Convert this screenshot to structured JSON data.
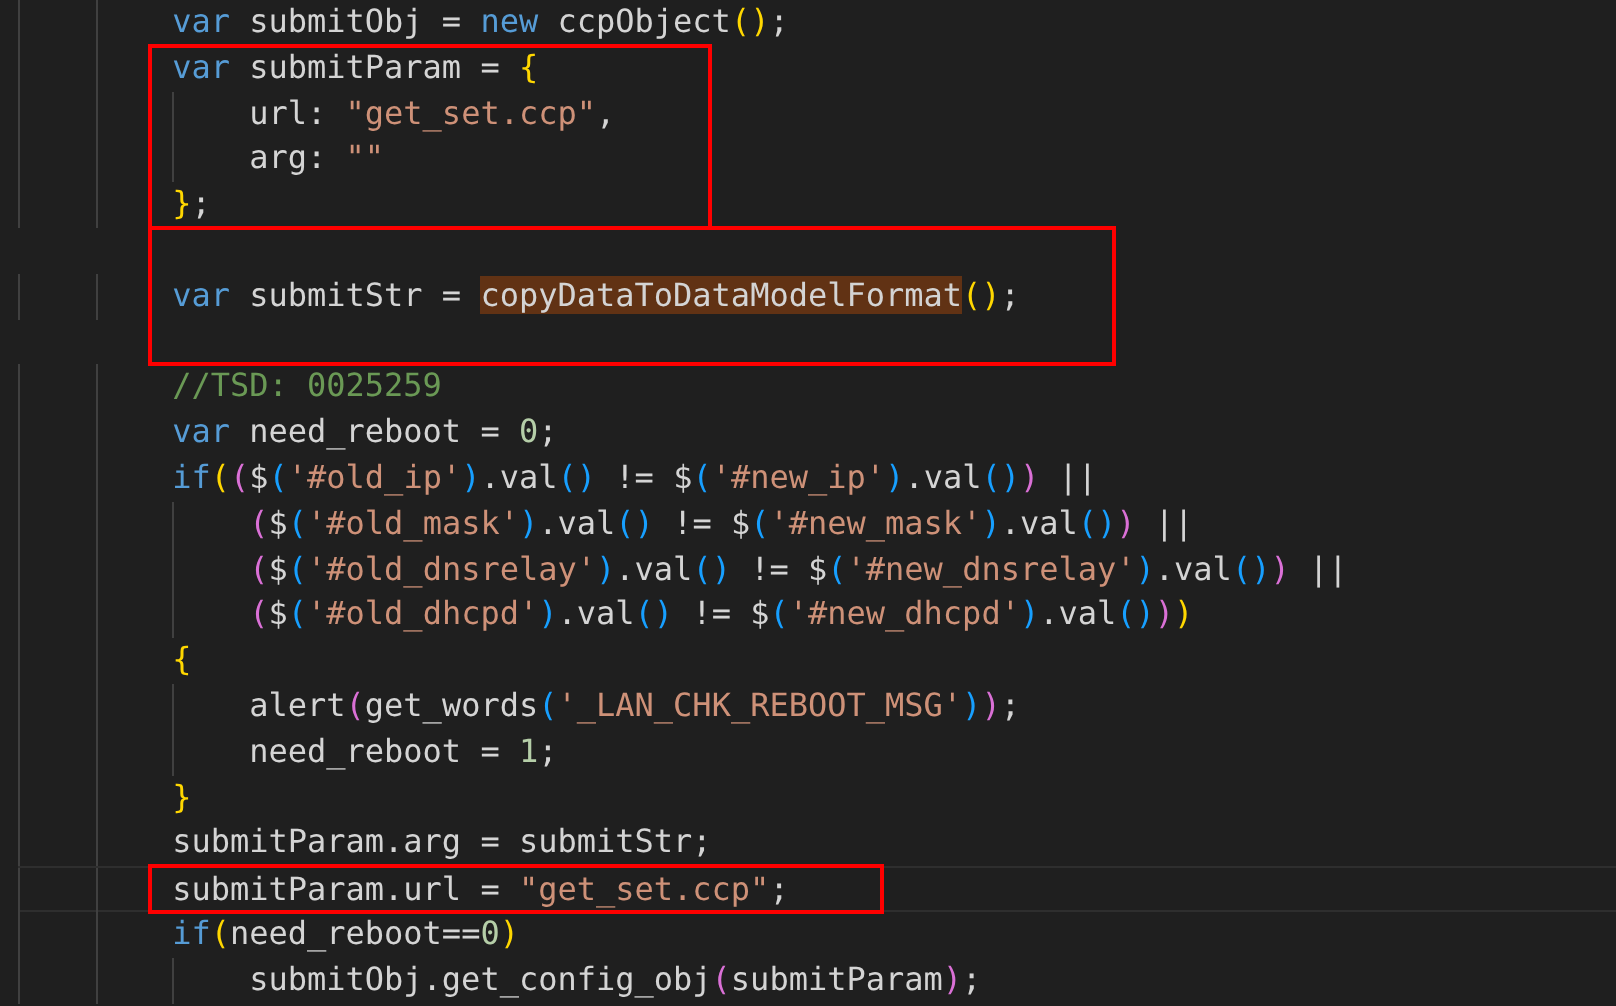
{
  "editor": {
    "sections": [
      {
        "boxed": false,
        "lines": [
          {
            "kind": "code",
            "tokens": [
              {
                "text": "        var",
                "kind": "kw"
              },
              {
                "text": " submitObj = ",
                "kind": "id"
              },
              {
                "text": "new",
                "kind": "kw"
              },
              {
                "text": " ccpObject",
                "kind": "id"
              },
              {
                "text": "()",
                "kind": "b1"
              },
              {
                "text": ";",
                "kind": "id"
              }
            ]
          }
        ]
      },
      {
        "boxed": true,
        "lines": [
          {
            "kind": "code",
            "tokens": [
              {
                "text": "        var",
                "kind": "kw"
              },
              {
                "text": " submitParam = ",
                "kind": "id"
              },
              {
                "text": "{",
                "kind": "b1"
              }
            ]
          },
          {
            "kind": "code",
            "tokens": [
              {
                "text": "            url: ",
                "kind": "id"
              },
              {
                "text": "\"get_set.ccp\"",
                "kind": "str"
              },
              {
                "text": ",",
                "kind": "id"
              }
            ]
          },
          {
            "kind": "code",
            "tokens": [
              {
                "text": "            arg: ",
                "kind": "id"
              },
              {
                "text": "\"\"",
                "kind": "str"
              }
            ]
          },
          {
            "kind": "code",
            "tokens": [
              {
                "text": "        }",
                "kind": "b1"
              },
              {
                "text": ";",
                "kind": "id"
              }
            ]
          }
        ]
      },
      {
        "boxed": true,
        "lines": [
          {
            "kind": "blank"
          },
          {
            "kind": "code",
            "tokens": [
              {
                "text": "        var",
                "kind": "kw"
              },
              {
                "text": " submitStr = ",
                "kind": "id"
              },
              {
                "text": "copyDataToDataModelFormat",
                "kind": "id",
                "highlighted": true
              },
              {
                "text": "()",
                "kind": "b1"
              },
              {
                "text": ";",
                "kind": "id"
              }
            ]
          },
          {
            "kind": "blank"
          }
        ]
      },
      {
        "boxed": false,
        "lines": [
          {
            "kind": "code",
            "tokens": [
              {
                "text": "        //TSD: 0025259",
                "kind": "cmt"
              }
            ]
          },
          {
            "kind": "code",
            "tokens": [
              {
                "text": "        var",
                "kind": "kw"
              },
              {
                "text": " need_reboot = ",
                "kind": "id"
              },
              {
                "text": "0",
                "kind": "num"
              },
              {
                "text": ";",
                "kind": "id"
              }
            ]
          },
          {
            "kind": "code",
            "tokens": [
              {
                "text": "        if",
                "kind": "kw"
              },
              {
                "text": "(",
                "kind": "b1"
              },
              {
                "text": "(",
                "kind": "b2"
              },
              {
                "text": "$",
                "kind": "id"
              },
              {
                "text": "(",
                "kind": "b3"
              },
              {
                "text": "'#old_ip'",
                "kind": "str"
              },
              {
                "text": ")",
                "kind": "b3"
              },
              {
                "text": ".val",
                "kind": "id"
              },
              {
                "text": "()",
                "kind": "b3"
              },
              {
                "text": " != $",
                "kind": "id"
              },
              {
                "text": "(",
                "kind": "b3"
              },
              {
                "text": "'#new_ip'",
                "kind": "str"
              },
              {
                "text": ")",
                "kind": "b3"
              },
              {
                "text": ".val",
                "kind": "id"
              },
              {
                "text": "()",
                "kind": "b3"
              },
              {
                "text": ")",
                "kind": "b2"
              },
              {
                "text": " ||",
                "kind": "id"
              }
            ]
          },
          {
            "kind": "code",
            "tokens": [
              {
                "text": "            (",
                "kind": "b2"
              },
              {
                "text": "$",
                "kind": "id"
              },
              {
                "text": "(",
                "kind": "b3"
              },
              {
                "text": "'#old_mask'",
                "kind": "str"
              },
              {
                "text": ")",
                "kind": "b3"
              },
              {
                "text": ".val",
                "kind": "id"
              },
              {
                "text": "()",
                "kind": "b3"
              },
              {
                "text": " != $",
                "kind": "id"
              },
              {
                "text": "(",
                "kind": "b3"
              },
              {
                "text": "'#new_mask'",
                "kind": "str"
              },
              {
                "text": ")",
                "kind": "b3"
              },
              {
                "text": ".val",
                "kind": "id"
              },
              {
                "text": "()",
                "kind": "b3"
              },
              {
                "text": ")",
                "kind": "b2"
              },
              {
                "text": " ||",
                "kind": "id"
              }
            ]
          },
          {
            "kind": "code",
            "tokens": [
              {
                "text": "            (",
                "kind": "b2"
              },
              {
                "text": "$",
                "kind": "id"
              },
              {
                "text": "(",
                "kind": "b3"
              },
              {
                "text": "'#old_dnsrelay'",
                "kind": "str"
              },
              {
                "text": ")",
                "kind": "b3"
              },
              {
                "text": ".val",
                "kind": "id"
              },
              {
                "text": "()",
                "kind": "b3"
              },
              {
                "text": " != $",
                "kind": "id"
              },
              {
                "text": "(",
                "kind": "b3"
              },
              {
                "text": "'#new_dnsrelay'",
                "kind": "str"
              },
              {
                "text": ")",
                "kind": "b3"
              },
              {
                "text": ".val",
                "kind": "id"
              },
              {
                "text": "()",
                "kind": "b3"
              },
              {
                "text": ")",
                "kind": "b2"
              },
              {
                "text": " ||",
                "kind": "id"
              }
            ]
          },
          {
            "kind": "code",
            "tokens": [
              {
                "text": "            (",
                "kind": "b2"
              },
              {
                "text": "$",
                "kind": "id"
              },
              {
                "text": "(",
                "kind": "b3"
              },
              {
                "text": "'#old_dhcpd'",
                "kind": "str"
              },
              {
                "text": ")",
                "kind": "b3"
              },
              {
                "text": ".val",
                "kind": "id"
              },
              {
                "text": "()",
                "kind": "b3"
              },
              {
                "text": " != $",
                "kind": "id"
              },
              {
                "text": "(",
                "kind": "b3"
              },
              {
                "text": "'#new_dhcpd'",
                "kind": "str"
              },
              {
                "text": ")",
                "kind": "b3"
              },
              {
                "text": ".val",
                "kind": "id"
              },
              {
                "text": "()",
                "kind": "b3"
              },
              {
                "text": ")",
                "kind": "b2"
              },
              {
                "text": ")",
                "kind": "b1"
              }
            ]
          },
          {
            "kind": "code",
            "tokens": [
              {
                "text": "        {",
                "kind": "b1"
              }
            ]
          },
          {
            "kind": "code",
            "tokens": [
              {
                "text": "            alert",
                "kind": "id"
              },
              {
                "text": "(",
                "kind": "b2"
              },
              {
                "text": "get_words",
                "kind": "id"
              },
              {
                "text": "(",
                "kind": "b3"
              },
              {
                "text": "'_LAN_CHK_REBOOT_MSG'",
                "kind": "str"
              },
              {
                "text": ")",
                "kind": "b3"
              },
              {
                "text": ")",
                "kind": "b2"
              },
              {
                "text": ";",
                "kind": "id"
              }
            ]
          },
          {
            "kind": "code",
            "tokens": [
              {
                "text": "            need_reboot = ",
                "kind": "id"
              },
              {
                "text": "1",
                "kind": "num"
              },
              {
                "text": ";",
                "kind": "id"
              }
            ]
          },
          {
            "kind": "code",
            "tokens": [
              {
                "text": "        }",
                "kind": "b1"
              }
            ]
          },
          {
            "kind": "code",
            "tokens": [
              {
                "text": "        submitParam.arg = submitStr;",
                "kind": "id"
              }
            ]
          }
        ]
      },
      {
        "boxed": true,
        "lines": [
          {
            "kind": "code",
            "current": true,
            "tokens": [
              {
                "text": "        submitParam.url = ",
                "kind": "id"
              },
              {
                "text": "\"get_set.ccp\"",
                "kind": "str"
              },
              {
                "text": ";",
                "kind": "id"
              }
            ]
          }
        ]
      },
      {
        "boxed": false,
        "lines": [
          {
            "kind": "code",
            "tokens": [
              {
                "text": "        if",
                "kind": "kw"
              },
              {
                "text": "(",
                "kind": "b1"
              },
              {
                "text": "need_reboot==",
                "kind": "id"
              },
              {
                "text": "0",
                "kind": "num"
              },
              {
                "text": ")",
                "kind": "b1"
              }
            ]
          },
          {
            "kind": "code",
            "tokens": [
              {
                "text": "            submitObj.get_config_obj",
                "kind": "id"
              },
              {
                "text": "(",
                "kind": "b2"
              },
              {
                "text": "submitParam",
                "kind": "id"
              },
              {
                "text": ")",
                "kind": "b2"
              },
              {
                "text": ";",
                "kind": "id"
              }
            ]
          }
        ]
      }
    ]
  }
}
